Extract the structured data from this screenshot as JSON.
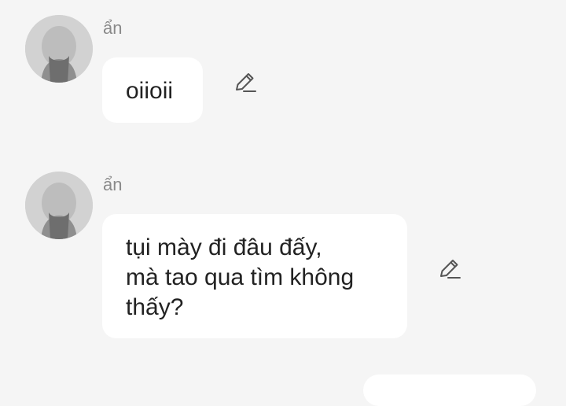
{
  "messages": [
    {
      "sender": "ẩn",
      "text": "oiioii",
      "edit_icon": "pencil-edit-icon"
    },
    {
      "sender": "ẩn",
      "text": "tụi mày đi đâu đấy,\nmà tao qua tìm không\nthấy?",
      "edit_icon": "pencil-edit-icon"
    }
  ],
  "colors": {
    "background": "#f5f5f5",
    "bubble": "#ffffff",
    "sender_text": "#8a8a8a",
    "message_text": "#222222",
    "icon": "#555555"
  }
}
